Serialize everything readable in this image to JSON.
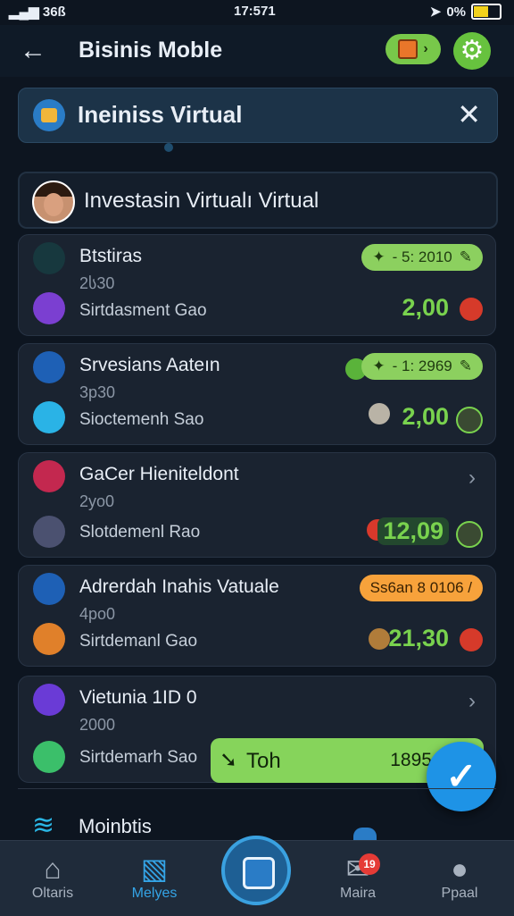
{
  "status_bar": {
    "left": "36ß",
    "time": "17:571",
    "right": "0%"
  },
  "header": {
    "title": "Bisinis Moble"
  },
  "banner": {
    "title": "Ineiniss Virtual"
  },
  "search": {
    "text": "Investasin Virtualı Virtual"
  },
  "cards": [
    {
      "title": "Btstiras",
      "sub": "2ს30",
      "desc": "Sirtdasment Gao",
      "pill": "- 5: 2010",
      "pill_color": "#8cd05f",
      "amount": "2,00",
      "icon_colors": [
        "#17383e",
        "#7b3fd1"
      ]
    },
    {
      "title": "Srvesians Aateın",
      "sub": "3p30",
      "desc": "Sioctemenh Sao",
      "pill": "- 1: 2969",
      "pill_color": "#8cd05f",
      "amount": "2,00",
      "icon_colors": [
        "#1e60b5",
        "#2ab3e6"
      ]
    },
    {
      "title": "GaCer Hieniteldont",
      "sub": "2yo0",
      "desc": "Slotdemenl Rao",
      "amount": "12,09",
      "icon_colors": [
        "#c3284f",
        "#4b5170"
      ]
    },
    {
      "title": "Adrerdah Inahis Vatuale",
      "sub": "4pο0",
      "desc": "Sirtdemanl Gao",
      "pill": "Ss6an 8 0106 /",
      "pill_color": "#f7a23b",
      "amount": "21,30",
      "icon_colors": [
        "#1e60b5",
        "#e0802a"
      ]
    },
    {
      "title": "Vietunia 1ID 0",
      "sub": "2000",
      "desc": "Sirtdemarh Sao",
      "icon_colors": [
        "#6a3bd6",
        "#3bbf6a"
      ]
    }
  ],
  "action_bar": {
    "label": "Toh",
    "value": "1895 · 10"
  },
  "partial_item": {
    "title": "Moinbtis"
  },
  "nav": [
    {
      "label": "Oltaris",
      "icon": "home-icon"
    },
    {
      "label": "Melyes",
      "icon": "chart-icon",
      "active": true
    },
    {
      "label": "",
      "icon": "center-icon"
    },
    {
      "label": "Maira",
      "icon": "mail-icon",
      "badge": "19"
    },
    {
      "label": "Ppaal",
      "icon": "person-icon"
    }
  ]
}
